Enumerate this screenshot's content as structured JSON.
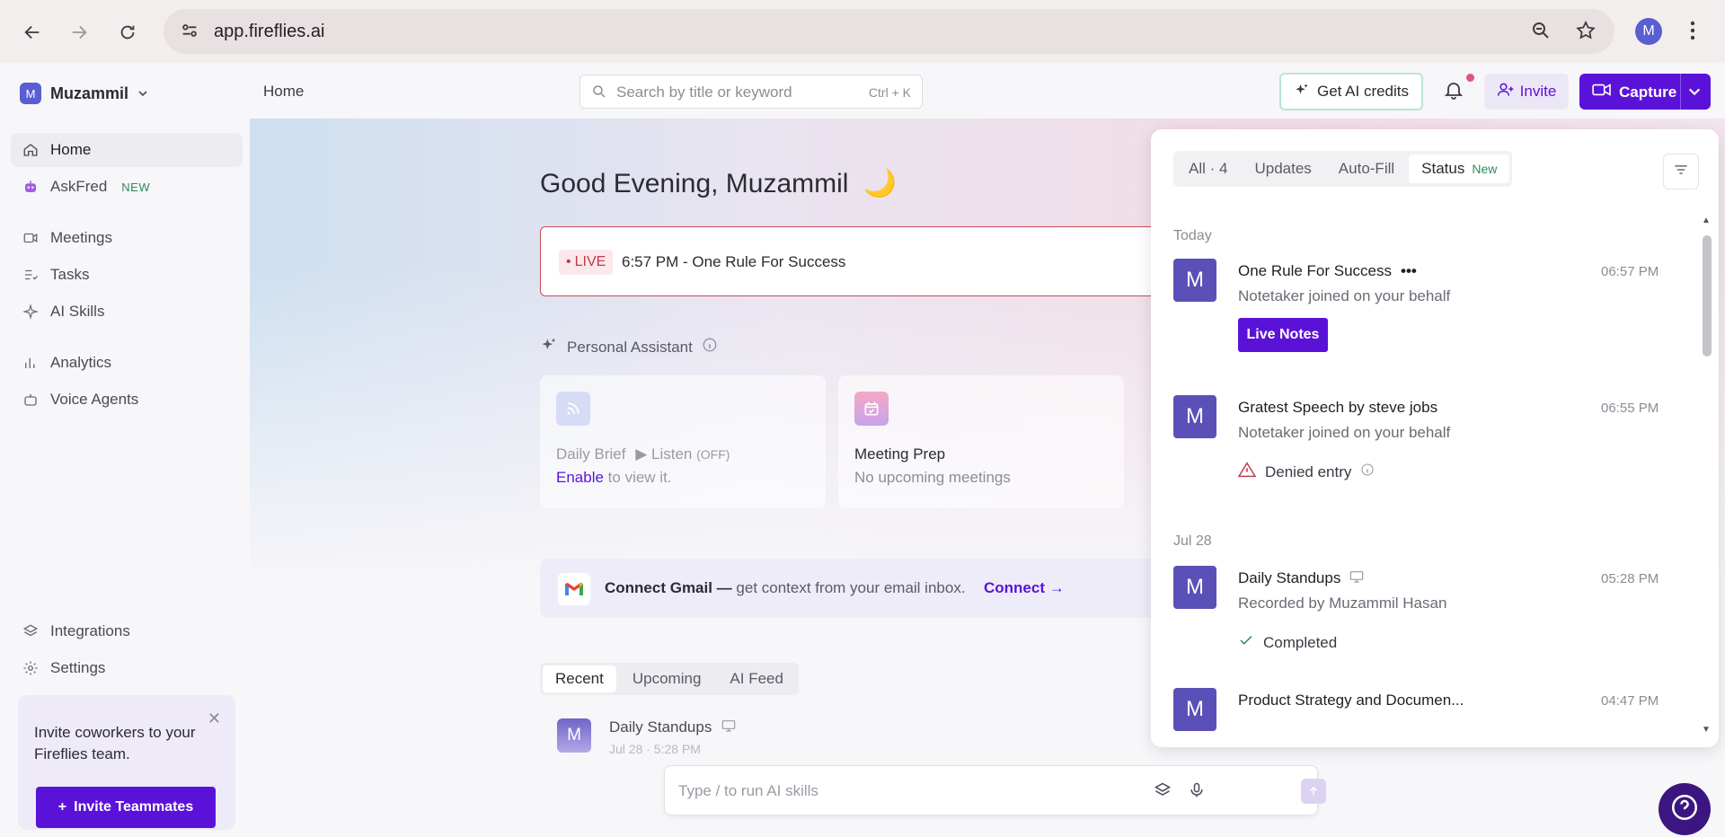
{
  "browser": {
    "url": "app.fireflies.ai",
    "profile_initial": "M"
  },
  "sidebar": {
    "workspace": {
      "initial": "M",
      "name": "Muzammil"
    },
    "items": [
      {
        "label": "Home"
      },
      {
        "label": "AskFred",
        "badge": "NEW"
      },
      {
        "label": "Meetings"
      },
      {
        "label": "Tasks"
      },
      {
        "label": "AI Skills"
      },
      {
        "label": "Analytics"
      },
      {
        "label": "Voice Agents"
      },
      {
        "label": "Integrations"
      },
      {
        "label": "Settings"
      }
    ],
    "invite_card": {
      "text": "Invite coworkers to your Fireflies team.",
      "button": "Invite Teammates"
    }
  },
  "topbar": {
    "breadcrumb": "Home",
    "search": {
      "placeholder": "Search by title or keyword",
      "shortcut": "Ctrl + K"
    },
    "credits_label": "Get AI credits",
    "invite_label": "Invite",
    "capture_label": "Capture"
  },
  "main": {
    "greeting": "Good Evening, Muzammil",
    "live": {
      "tag": "LIVE",
      "title": "6:57 PM - One Rule For Success"
    },
    "assistant_label": "Personal Assistant",
    "cards": [
      {
        "title": "Daily Brief",
        "listen": "Listen",
        "off": "(OFF)",
        "enable": "Enable",
        "sub": "to view it."
      },
      {
        "title": "Meeting Prep",
        "sub": "No upcoming meetings"
      }
    ],
    "gmail": {
      "bold": "Connect Gmail —",
      "text": "get context from your email inbox.",
      "link": "Connect"
    },
    "tabs": [
      "Recent",
      "Upcoming",
      "AI Feed"
    ],
    "recent": {
      "initial": "M",
      "title": "Daily Standups",
      "sub": "Jul 28 · 5:28 PM"
    },
    "ai_input_placeholder": "Type / to run AI skills"
  },
  "panel": {
    "tabs": [
      {
        "label": "All · 4"
      },
      {
        "label": "Updates"
      },
      {
        "label": "Auto-Fill"
      },
      {
        "label": "Status",
        "badge": "New"
      }
    ],
    "groups": [
      {
        "day": "Today"
      },
      {
        "day": "Jul 28"
      }
    ],
    "notifications": [
      {
        "initial": "M",
        "title": "One Rule For Success",
        "sub": "Notetaker joined on your behalf",
        "time": "06:57 PM",
        "action": "Live Notes"
      },
      {
        "initial": "M",
        "title": "Gratest Speech by steve jobs",
        "sub": "Notetaker joined on your behalf",
        "time": "06:55 PM",
        "status": "Denied entry"
      },
      {
        "initial": "M",
        "title": "Daily Standups",
        "sub": "Recorded by Muzammil Hasan",
        "time": "05:28 PM",
        "status": "Completed"
      },
      {
        "initial": "M",
        "title": "Product Strategy and Documen...",
        "time": "04:47 PM"
      }
    ]
  },
  "colors": {
    "brand": "#5b12d8",
    "live": "#c23a4a",
    "new_badge": "#2c8a5c",
    "avatar": "#5b50b8"
  }
}
